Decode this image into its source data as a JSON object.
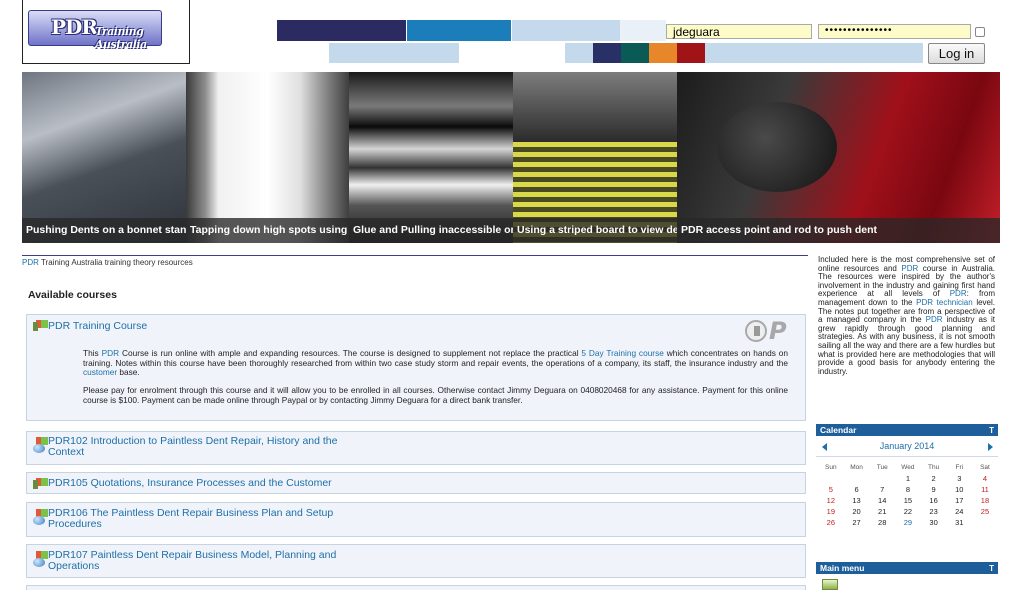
{
  "header": {
    "logo_text_big": "PDR",
    "logo_text_small": "Training Australia",
    "swatch_colors": [
      "#2b2b62",
      "#1b7dba",
      "#c5d9ec",
      "#e9f0f8",
      "#283066",
      "#0a5a55",
      "#e8862a",
      "#a01418"
    ],
    "username_value": "jdeguara",
    "password_value": "•••••••••••••••",
    "login_label": "Log in"
  },
  "slides": [
    {
      "caption": "Pushing Dents on a bonnet stand"
    },
    {
      "caption": "Tapping down high spots using a knockdown"
    },
    {
      "caption": "Glue and Pulling inaccessible or difficult dents"
    },
    {
      "caption": "Using a striped board to view dents"
    },
    {
      "caption": "PDR access point and rod to push dent"
    }
  ],
  "breadcrumb": {
    "link": "PDR",
    "rest": " Training Australia training theory resources"
  },
  "available_courses_heading": "Available courses",
  "featured_course": {
    "title": "PDR Training Course",
    "p1_a": "This ",
    "p1_link1": "PDR",
    "p1_b": " Course is run online with ample and expanding resources. The course is designed to supplement not replace the practical ",
    "p1_link2": "5 Day Training course",
    "p1_c": " which concentrates on hands on training. Notes within this course have been thoroughly researched from within two case study storm and repair events, the operations of a company, its staff, the insurance industry and the ",
    "p1_link3": "customer",
    "p1_d": " base.",
    "p2": "Please pay for enrolment through this course and it will allow you to be enrolled in all courses. Otherwise contact Jimmy Deguara on 0408020468 for any assistance. Payment for this online course is $100. Payment can be made online through Paypal or by contacting Jimmy Deguara for a direct bank transfer."
  },
  "courses": [
    {
      "line1": "PDR102 Introduction to Paintless Dent Repair, History and the",
      "line2": "Context"
    },
    {
      "line1": "PDR105 Quotations, Insurance Processes and the Customer",
      "line2": ""
    },
    {
      "line1": "PDR106 The Paintless Dent Repair Business Plan and Setup",
      "line2": "Procedures"
    },
    {
      "line1": "PDR107 Paintless Dent Repair Business Model, Planning and",
      "line2": "Operations"
    }
  ],
  "sidebar": {
    "intro_a": "Included here is the most comprehensive set of online resources and ",
    "intro_link1": "PDR",
    "intro_b": " course in Australia. The resources were inspired by the author's involvement in the industry and gaining first hand experience at all levels of ",
    "intro_link2": "PDR",
    "intro_c": ": from management down to the ",
    "intro_link3": "PDR technician",
    "intro_d": " level. The notes put together are from a perspective of a managed company in the ",
    "intro_link4": "PDR",
    "intro_e": " industry as it grew rapidly through good planning and strategies. As with any business, it is not smooth sailing all the way and there are a few hurdles but what is provided here are methodologies that will provide a good basis for anybody entering the industry.",
    "calendar_title": "Calendar",
    "calendar_month": "January 2014",
    "weekdays": [
      "Sun",
      "Mon",
      "Tue",
      "Wed",
      "Thu",
      "Fri",
      "Sat"
    ],
    "weeks": [
      [
        "",
        "",
        "",
        "1",
        "2",
        "3",
        "4"
      ],
      [
        "5",
        "6",
        "7",
        "8",
        "9",
        "10",
        "11"
      ],
      [
        "12",
        "13",
        "14",
        "15",
        "16",
        "17",
        "18"
      ],
      [
        "19",
        "20",
        "21",
        "22",
        "23",
        "24",
        "25"
      ],
      [
        "26",
        "27",
        "28",
        "29",
        "30",
        "31",
        ""
      ]
    ],
    "main_menu_title": "Main menu",
    "toggle_glyph": "T"
  }
}
